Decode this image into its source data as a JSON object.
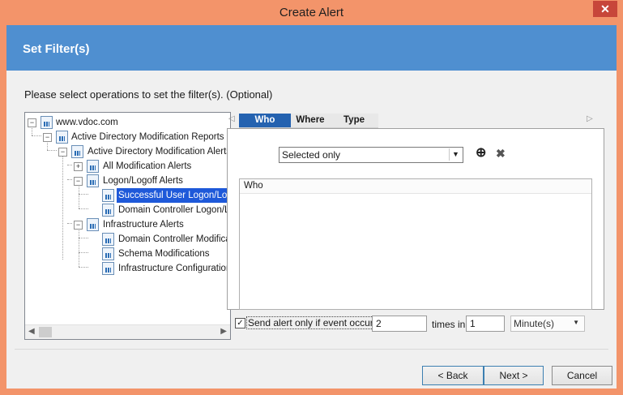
{
  "window": {
    "title": "Create Alert",
    "close_glyph": "✕"
  },
  "header": {
    "title": "Set Filter(s)"
  },
  "instructions": "Please select operations to set the filter(s). (Optional)",
  "tree": {
    "root": "www.vdoc.com",
    "reports": "Active Directory Modification Reports",
    "alerts": "Active Directory Modification Alerts",
    "all_mod": "All Modification Alerts",
    "logon_group": "Logon/Logoff Alerts",
    "logon_success": "Successful User Logon/Lo",
    "dc_logon": "Domain Controller Logon/Lo",
    "infra_group": "Infrastructure Alerts",
    "dc_mod": "Domain Controller Modificat",
    "schema": "Schema Modifications",
    "infra_config": "Infrastructure Configuration"
  },
  "tabs": [
    "Who",
    "Where",
    "Type"
  ],
  "filter": {
    "selected_value": "Selected only",
    "add_icon": "⊕",
    "remove_icon": "✖",
    "list_header": "Who"
  },
  "send_alert": {
    "checked": true,
    "label": "Send alert only if event occurs",
    "count": "2",
    "times_in_label": "times in",
    "period": "1",
    "unit": "Minute(s)"
  },
  "buttons": {
    "back": "< Back",
    "next": "Next >",
    "cancel": "Cancel"
  }
}
